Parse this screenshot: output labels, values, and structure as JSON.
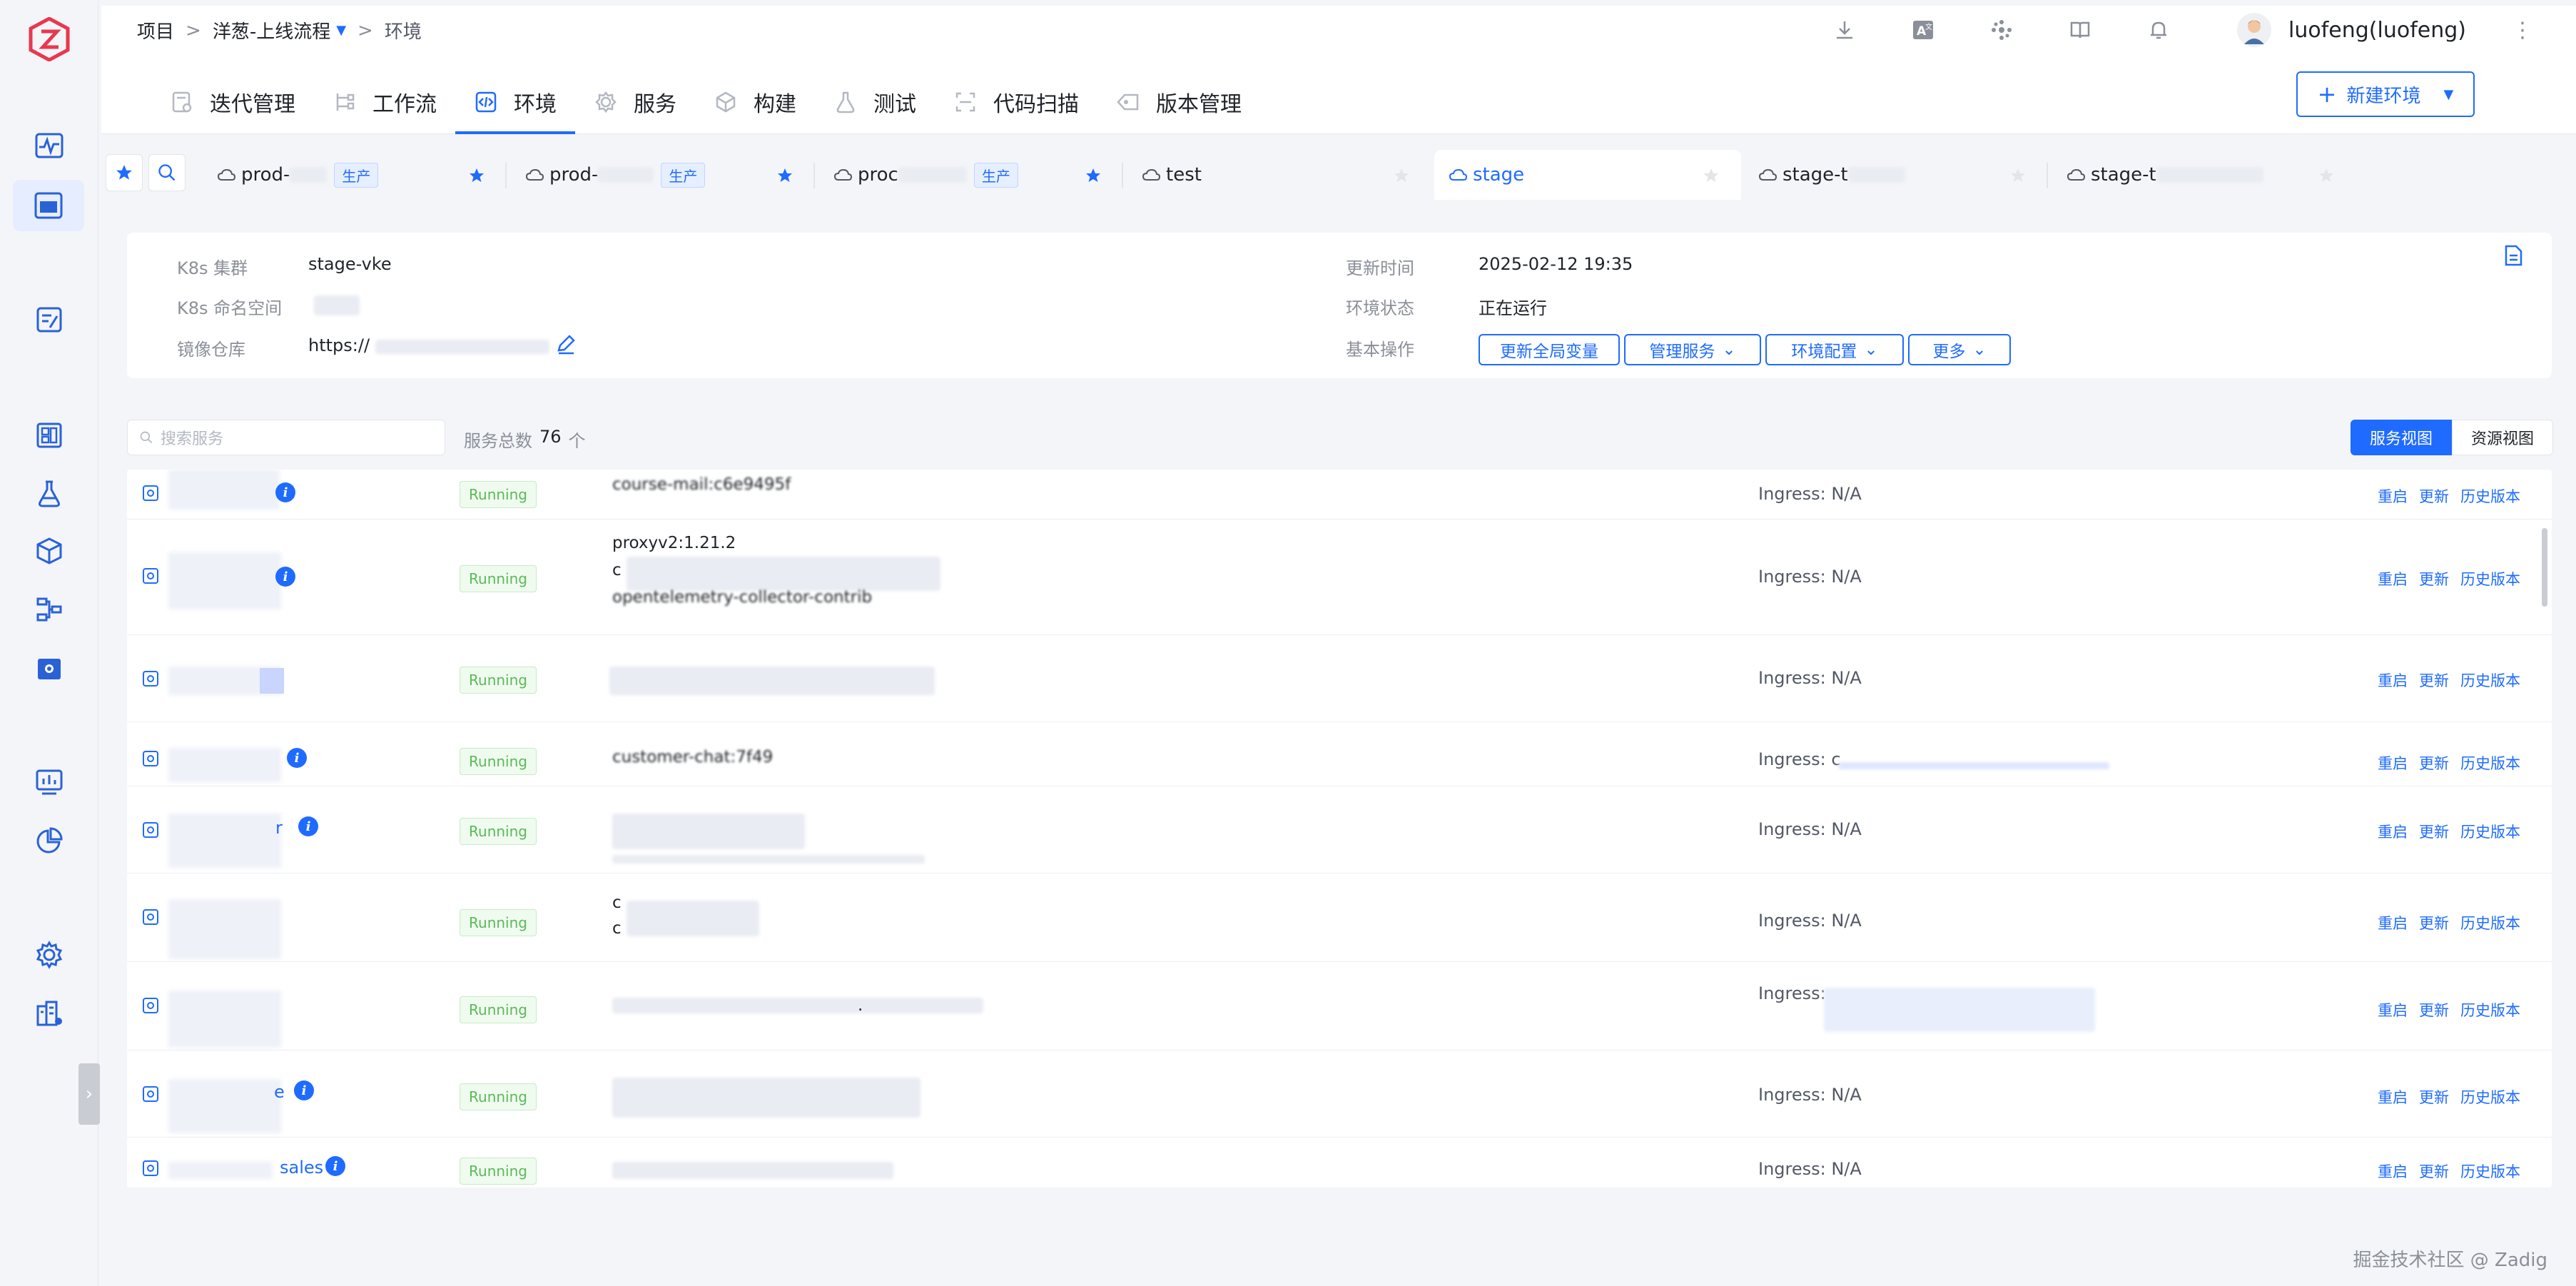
{
  "breadcrumb": {
    "root": "项目",
    "project": "洋葱-上线流程",
    "current": "环境"
  },
  "user": {
    "name": "luofeng(luofeng)"
  },
  "nav_tabs": [
    {
      "label": "迭代管理",
      "icon": "iteration-icon"
    },
    {
      "label": "工作流",
      "icon": "workflow-icon"
    },
    {
      "label": "环境",
      "icon": "code-env-icon",
      "active": true
    },
    {
      "label": "服务",
      "icon": "service-icon"
    },
    {
      "label": "构建",
      "icon": "build-icon"
    },
    {
      "label": "测试",
      "icon": "test-flask-icon"
    },
    {
      "label": "代码扫描",
      "icon": "scan-icon"
    },
    {
      "label": "版本管理",
      "icon": "version-icon"
    }
  ],
  "new_env_button": "新建环境",
  "env_tabs": [
    {
      "label": "prod-",
      "tag": "生产",
      "starred": true
    },
    {
      "label": "prod-",
      "tag": "生产",
      "starred": true
    },
    {
      "label": "proc",
      "tag": "生产",
      "starred": true
    },
    {
      "label": "test",
      "tag": "",
      "starred": false
    },
    {
      "label": "stage",
      "tag": "",
      "starred": false,
      "active": true
    },
    {
      "label": "stage-t",
      "tag": "",
      "starred": false
    },
    {
      "label": "stage-t",
      "tag": "",
      "starred": false
    }
  ],
  "info": {
    "k8s_cluster_label": "K8s 集群",
    "k8s_cluster": "stage-vke",
    "k8s_ns_label": "K8s 命名空间",
    "registry_label": "镜像仓库",
    "registry": "https://",
    "updated_label": "更新时间",
    "updated": "2025-02-12 19:35",
    "status_label": "环境状态",
    "status": "正在运行",
    "ops_label": "基本操作",
    "ops": [
      "更新全局变量",
      "管理服务",
      "环境配置",
      "更多"
    ]
  },
  "services_header": {
    "search_placeholder": "搜索服务",
    "count_label": "服务总数",
    "count": "76",
    "count_unit": "个",
    "view_service": "服务视图",
    "view_resource": "资源视图"
  },
  "rows": [
    {
      "suffix": "",
      "status": "Running",
      "image": [
        "course-mail:c6e9495f"
      ],
      "ingress": "Ingress: N/A"
    },
    {
      "suffix": "",
      "status": "Running",
      "image": [
        "proxyv2:1.21.2",
        "c",
        "opentelemetry-collector-contrib"
      ],
      "ingress": "Ingress: N/A"
    },
    {
      "suffix": "",
      "status": "Running",
      "image": [
        ""
      ],
      "ingress": "Ingress: N/A"
    },
    {
      "suffix": "",
      "status": "Running",
      "image": [
        "customer-chat:7f49"
      ],
      "ingress": "Ingress: c"
    },
    {
      "suffix": "r",
      "status": "Running",
      "image": [
        ""
      ],
      "ingress": "Ingress: N/A"
    },
    {
      "suffix": "",
      "status": "Running",
      "image": [
        "c",
        "c"
      ],
      "ingress": "Ingress: N/A"
    },
    {
      "suffix": "",
      "status": "Running",
      "image": [
        "."
      ],
      "ingress": "Ingress:"
    },
    {
      "suffix": "e",
      "status": "Running",
      "image": [
        "",
        ""
      ],
      "ingress": "Ingress: N/A"
    },
    {
      "suffix": "sales",
      "status": "Running",
      "image": [
        ""
      ],
      "ingress": "Ingress: N/A"
    }
  ],
  "row_actions": {
    "restart": "重启",
    "update": "更新",
    "history": "历史版本"
  },
  "footer": "掘金技术社区 @ Zadig",
  "colors": {
    "accent": "#1f6bff",
    "running_text": "#5aba58",
    "logo": "#e8384f"
  }
}
